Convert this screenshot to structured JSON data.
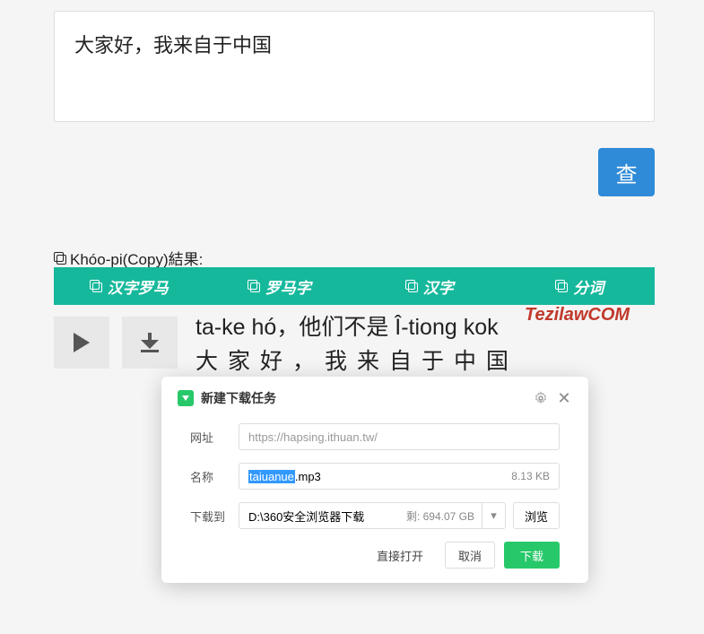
{
  "input": {
    "text": "大家好，我来自于中国"
  },
  "search_button": "查",
  "copy_results_label": "Khóo-pi(Copy)結果:",
  "tabs": [
    {
      "label": "汉字罗马"
    },
    {
      "label": "罗马字"
    },
    {
      "label": "汉字"
    },
    {
      "label": "分词"
    }
  ],
  "watermark": "TezilawCOM",
  "result": {
    "latin": "ta-ke hó，他们不是 Î-tiong kok",
    "hanzi": "大家好，我来自于中国"
  },
  "dialog": {
    "title": "新建下载任务",
    "labels": {
      "url": "网址",
      "name": "名称",
      "saveto": "下载到"
    },
    "url": "https://hapsing.ithuan.tw/",
    "filename_selected": "taiuanue",
    "filename_rest": ".mp3",
    "filesize": "8.13 KB",
    "path": "D:\\360安全浏览器下载",
    "remaining": "剩: 694.07 GB",
    "browse": "浏览",
    "open_direct": "直接打开",
    "cancel": "取消",
    "download": "下载"
  }
}
